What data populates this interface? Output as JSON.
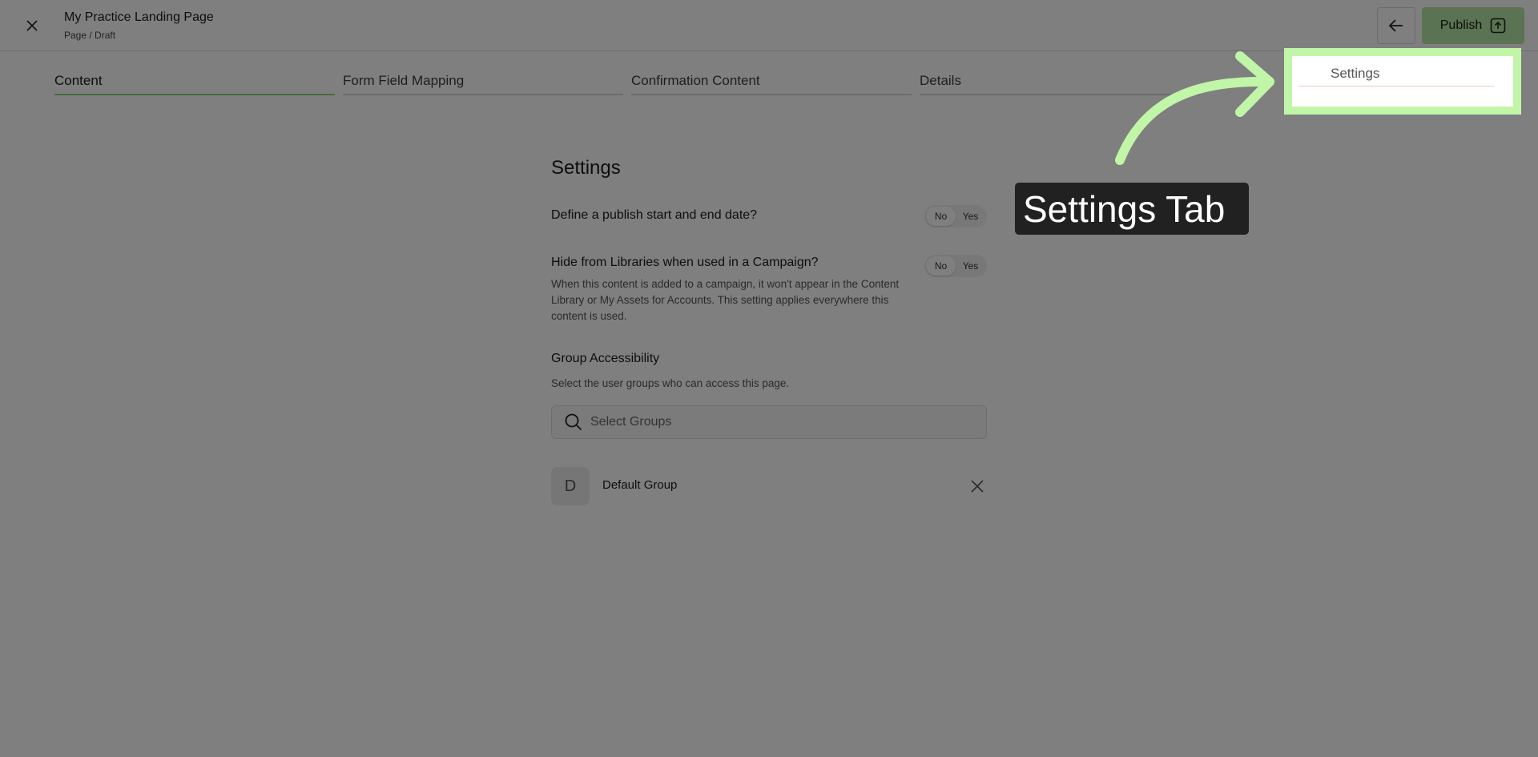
{
  "header": {
    "title": "My Practice Landing Page",
    "subtitle": "Page / Draft",
    "publish_label": "Publish"
  },
  "tabs": [
    {
      "label": "Content",
      "active": true
    },
    {
      "label": "Form Field Mapping",
      "active": false
    },
    {
      "label": "Confirmation Content",
      "active": false
    },
    {
      "label": "Details",
      "active": false
    },
    {
      "label": "Settings",
      "active": false
    }
  ],
  "settings": {
    "heading": "Settings",
    "publish_dates": {
      "label": "Define a publish start and end date?",
      "no": "No",
      "yes": "Yes",
      "selected": "No"
    },
    "hide_libraries": {
      "label": "Hide from Libraries when used in a Campaign?",
      "no": "No",
      "yes": "Yes",
      "selected": "No",
      "help": "When this content is added to a campaign, it won't appear in the Content Library or My Assets for Accounts. This setting applies everywhere this content is used."
    },
    "group_access": {
      "label": "Group Accessibility",
      "help": "Select the user groups who can access this page.",
      "search_placeholder": "Select Groups",
      "groups": [
        {
          "initial": "D",
          "name": "Default Group"
        }
      ]
    }
  },
  "annotation": {
    "callout_text": "Settings Tab",
    "highlight_color": "#c1f5a8"
  },
  "colors": {
    "accent_green": "#8ed67a",
    "publish_bg": "#b5e6a6",
    "overlay": "rgba(0,0,0,0.5)"
  }
}
